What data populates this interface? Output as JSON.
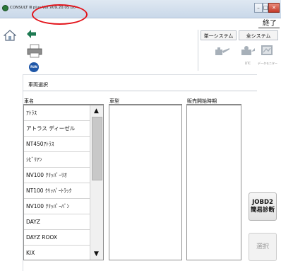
{
  "titlebar": {
    "title": "CONSULT Ⅲ plus  Ver.V09.20.05.00",
    "minimize_glyph": "–",
    "maximize_glyph": "□",
    "close_glyph": "✕"
  },
  "toolbar": {
    "quit_label": "終了",
    "single_system_label": "単一システム",
    "all_system_label": "全システム",
    "dtc_label": "DTC",
    "data_monitor_label": "データモニター",
    "bubble_label": "RUN"
  },
  "section": {
    "title": "車両選択"
  },
  "columns": {
    "vehicle_name": "車名",
    "model": "車型",
    "sale_start": "販売開始時期"
  },
  "vehicle_list": [
    "ｱﾄﾗｽ",
    "アトラス ディーゼル",
    "NT450ｱﾄﾗｽ",
    "ｼﾋﾞﾘｱﾝ",
    "NV100 ｸﾘｯﾊﾟｰﾘｵ",
    "NT100 ｸﾘｯﾊﾟｰﾄﾗｯｸ",
    "NV100 ｸﾘｯﾊﾟｰﾊﾞﾝ",
    "DAYZ",
    "DAYZ ROOX",
    "KIX"
  ],
  "buttons": {
    "jobd2_line1": "JOBD2",
    "jobd2_line2": "簡易診断",
    "select": "選択"
  },
  "icons": {
    "home": "home-icon",
    "back": "back-arrow-icon",
    "printer": "printer-icon",
    "scroll_up": "▲",
    "scroll_down": "▼"
  },
  "colors": {
    "annotation": "#e3141b",
    "back_arrow": "#1e7a52",
    "bubble": "#1f57a8"
  }
}
